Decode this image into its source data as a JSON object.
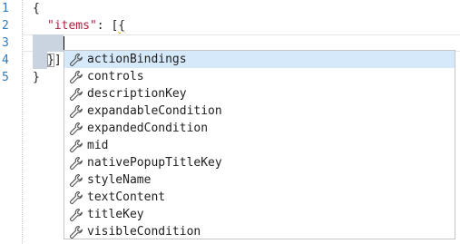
{
  "editor": {
    "line_numbers": [
      "1",
      "2",
      "3",
      "4",
      "5"
    ],
    "lines": {
      "l1_brace": "{",
      "l2_key": "\"items\"",
      "l2_colon": ": ",
      "l2_open_bracket": "[",
      "l2_open_brace": "{",
      "l4_close_brace": "}",
      "l4_close_bracket": "]",
      "l5_brace": "}"
    }
  },
  "suggest": {
    "items": [
      {
        "label": "actionBindings",
        "icon": "wrench-icon",
        "selected": true
      },
      {
        "label": "controls",
        "icon": "wrench-icon"
      },
      {
        "label": "descriptionKey",
        "icon": "wrench-icon"
      },
      {
        "label": "expandableCondition",
        "icon": "wrench-icon"
      },
      {
        "label": "expandedCondition",
        "icon": "wrench-icon"
      },
      {
        "label": "mid",
        "icon": "wrench-icon"
      },
      {
        "label": "nativePopupTitleKey",
        "icon": "wrench-icon"
      },
      {
        "label": "styleName",
        "icon": "wrench-icon"
      },
      {
        "label": "textContent",
        "icon": "wrench-icon"
      },
      {
        "label": "titleKey",
        "icon": "wrench-icon"
      },
      {
        "label": "visibleCondition",
        "icon": "wrench-icon"
      }
    ]
  },
  "colors": {
    "line_number": "#2e7cc4",
    "string": "#b01e3a",
    "selection": "#d6e9fb",
    "whitespace_highlight": "#c9d4e0"
  }
}
